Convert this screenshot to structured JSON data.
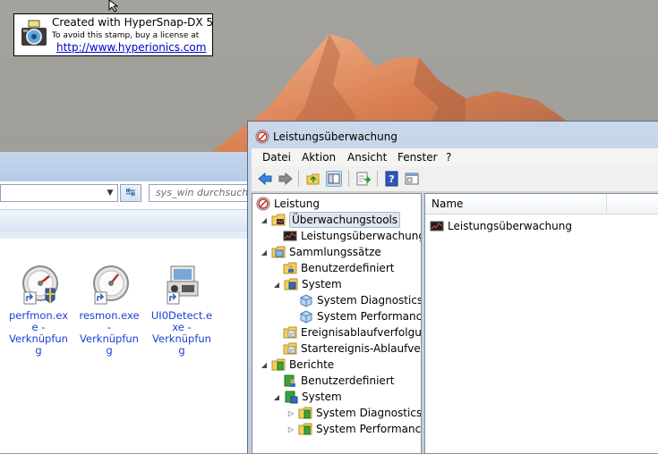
{
  "stamp": {
    "line1": "Created with HyperSnap-DX 5",
    "line2": "To avoid this stamp, buy a license at",
    "url": "http://www.hyperionics.com"
  },
  "explorer": {
    "search_placeholder": "sys_win durchsuchen",
    "files": [
      {
        "name": "perfmon.exe - Verknüpfung",
        "lines": [
          "perfmon.ex",
          "e -",
          "Verknüpfun",
          "g"
        ],
        "icon": "perfmon-gauge-icon"
      },
      {
        "name": "resmon.exe - Verknüpfung",
        "lines": [
          "resmon.exe",
          "-",
          "Verknüpfun",
          "g"
        ],
        "icon": "resmon-gauge-icon"
      },
      {
        "name": "UI0Detect.exe - Verknüpfung",
        "lines": [
          "UI0Detect.e",
          "xe -",
          "Verknüpfun",
          "g"
        ],
        "icon": "ui0detect-icon"
      }
    ]
  },
  "perfmon": {
    "title": "Leistungsüberwachung",
    "menu": [
      "Datei",
      "Aktion",
      "Ansicht",
      "Fenster",
      "?"
    ],
    "toolbar_icons": [
      "back-arrow-icon",
      "forward-arrow-icon",
      "up-folder-icon",
      "show-hide-tree-icon",
      "export-list-icon",
      "help-icon",
      "console-icon"
    ],
    "tree": {
      "root": "Leistung",
      "items": [
        "Überwachungstools",
        "Leistungsüberwachung",
        "Sammlungssätze",
        "Benutzerdefiniert",
        "System",
        "System Diagnostics",
        "System Performance",
        "Ereignisablaufverfolgungssitzungen",
        "Startereignis-Ablaufverfolgungssitzungen",
        "Berichte",
        "Benutzerdefiniert",
        "System",
        "System Diagnostics",
        "System Performance"
      ]
    },
    "list": {
      "column_name": "Name",
      "rows": [
        "Leistungsüberwachung"
      ]
    },
    "colors": {
      "title_bg": "#c9d7ea",
      "link": "#1a3fd0",
      "selection": "#dfe6f0"
    }
  }
}
